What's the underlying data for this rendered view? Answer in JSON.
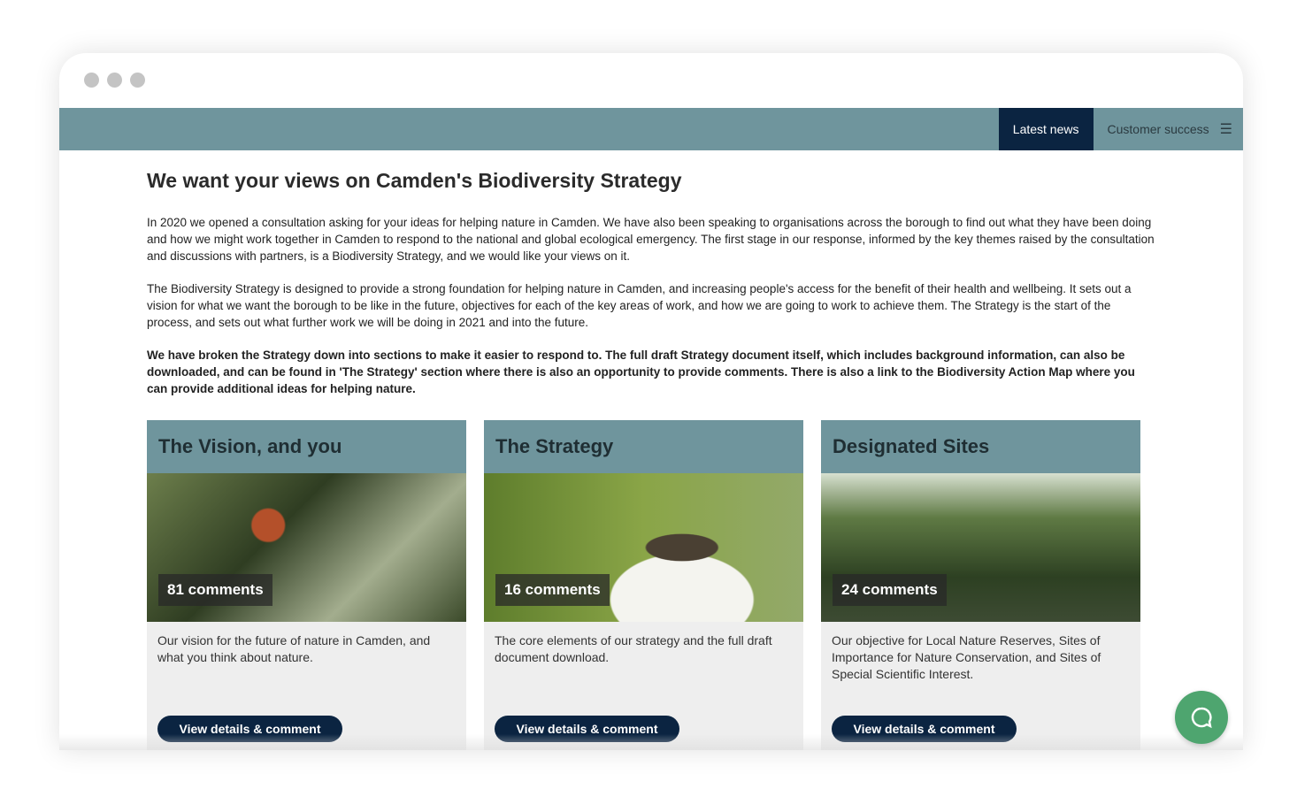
{
  "nav": {
    "latest": "Latest news",
    "customer": "Customer success",
    "menu_icon": "hamburger-icon"
  },
  "page": {
    "title": "We want your views on Camden's Biodiversity Strategy",
    "p1": "In 2020 we opened a consultation asking for your ideas for helping nature in Camden. We have also been speaking to organisations across the borough to find out what they have been doing and how we might work together in Camden to respond to the national and global ecological emergency. The first stage in our response, informed by the key themes raised by the consultation and discussions with partners, is a Biodiversity Strategy, and we would like your views on it.",
    "p2": "The Biodiversity Strategy is designed to provide a strong foundation for helping nature in Camden, and increasing people's access for the benefit of their health and wellbeing. It sets out a vision for what we want the borough to be like in the future, objectives for each of the key areas of work, and how we are going to work to achieve them. The Strategy is the start of the process, and sets out what further work we will be doing in 2021 and into the future.",
    "p3": "We have broken the Strategy down into sections to make it easier to respond to. The full draft Strategy document itself, which includes background information, can also be downloaded, and can be found in 'The Strategy' section where there is also an opportunity to provide comments. There is also a link to the Biodiversity Action Map where you can provide additional ideas for helping nature."
  },
  "cards": [
    {
      "title": "The Vision, and you",
      "comments": "81 comments",
      "desc": "Our vision for the future of nature in Camden, and what you think about nature.",
      "button": "View details & comment"
    },
    {
      "title": "The Strategy",
      "comments": "16 comments",
      "desc": "The core elements of our strategy and the full draft document download.",
      "button": "View details & comment"
    },
    {
      "title": "Designated Sites",
      "comments": "24 comments",
      "desc": "Our objective for Local Nature Reserves, Sites of Importance for Nature Conservation, and Sites of Special Scientific Interest.",
      "button": "View details & comment"
    }
  ],
  "colors": {
    "nav": "#6f959d",
    "primary": "#0b2441",
    "chat": "#4ea56f"
  }
}
